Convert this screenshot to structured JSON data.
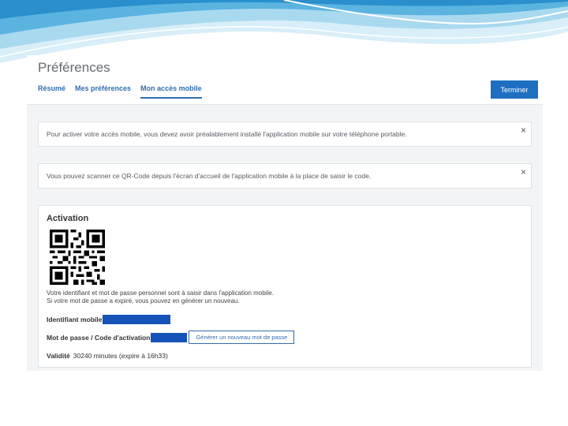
{
  "header": {
    "title": "Préférences",
    "tabs": [
      {
        "label": "Résumé"
      },
      {
        "label": "Mes préférences"
      },
      {
        "label": "Mon accès mobile"
      }
    ],
    "done_label": "Terminer"
  },
  "alerts": [
    {
      "text": "Pour activer votre accès mobile, vous devez avoir préalablement installé l'application mobile sur votre téléphone portable.",
      "close": "×"
    },
    {
      "text": "Vous pouvez scanner ce QR-Code depuis l'écran d'accueil de l'application mobile à la place de saisir le code.",
      "close": "×"
    }
  ],
  "activation": {
    "title": "Activation",
    "info_line1": "Votre identifiant et mot de passe personnel sont à saisir dans l'application mobile.",
    "info_line2": "Si votre mot de passe a expiré, vous pouvez en générer un nouveau.",
    "id_label": "Identifiant mobile",
    "password_label": "Mot de passe / Code d'activation",
    "generate_label": "Générer un nouveau mot de passe",
    "validity_label": "Validité",
    "validity_value": "30240 minutes (expire à 16h33)"
  },
  "colors": {
    "accent": "#1e6fc1",
    "link": "#2f6faf",
    "redaction": "#1553b8"
  }
}
